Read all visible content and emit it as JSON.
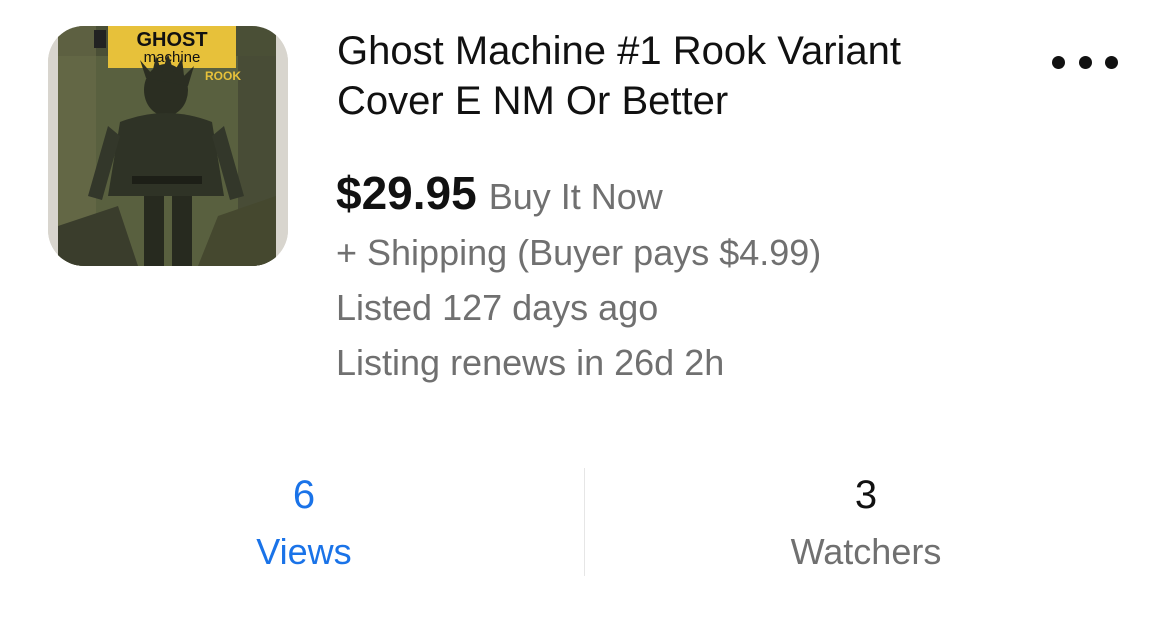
{
  "listing": {
    "title": "Ghost Machine #1 Rook Variant Cover E NM Or Better",
    "price": "$29.95",
    "format": "Buy It Now",
    "shipping": "+ Shipping (Buyer pays $4.99)",
    "listed": "Listed 127 days ago",
    "renews": "Listing renews in 26d 2h",
    "thumbnail": {
      "logo_line1": "GHOST",
      "logo_line2": "machine",
      "subtitle": "ROOK"
    }
  },
  "stats": {
    "views": {
      "value": "6",
      "label": "Views",
      "color": "#1a73e8"
    },
    "watchers": {
      "value": "3",
      "label": "Watchers"
    }
  },
  "icons": {
    "more": "more-horizontal-icon"
  }
}
